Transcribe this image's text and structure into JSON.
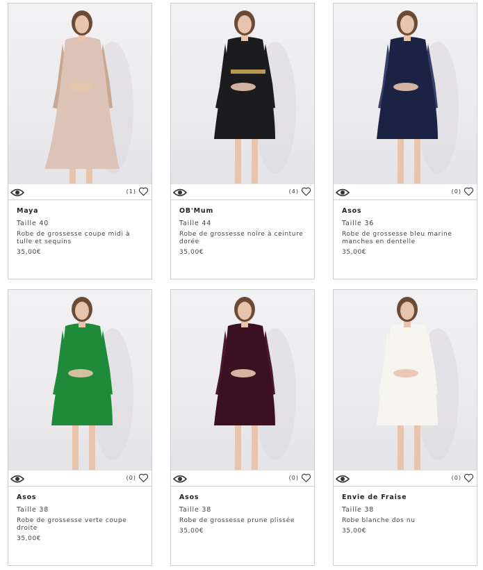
{
  "products": [
    {
      "brand": "Maya",
      "size": "Taille 40",
      "description": "Robe de grossesse coupe midi à tulle et sequins",
      "price": "35,00€",
      "likes": "(1)",
      "dress_color": "#dcc3b5",
      "sleeve_color": "#c7a894"
    },
    {
      "brand": "OB'Mum",
      "size": "Taille 44",
      "description": "Robe de grossesse noire à ceinture dorée",
      "price": "35,00€",
      "likes": "(4)",
      "dress_color": "#1c1c1e",
      "sleeve_color": "#1c1c1e",
      "belt_color": "#b79a52"
    },
    {
      "brand": "Asos",
      "size": "Taille 36",
      "description": "Robe de grossesse bleu marine manches en dentelle",
      "price": "35,00€",
      "likes": "(0)",
      "dress_color": "#1b2244",
      "sleeve_color": "#39406a"
    },
    {
      "brand": "Asos",
      "size": "Taille 38",
      "description": "Robe de grossesse verte coupe droite",
      "price": "35,00€",
      "likes": "(0)",
      "dress_color": "#1f8a3a",
      "sleeve_color": "#1f8a3a"
    },
    {
      "brand": "Asos",
      "size": "Taille 38",
      "description": "Robe de grossesse prune plissée",
      "price": "35,00€",
      "likes": "(0)",
      "dress_color": "#3b1020",
      "sleeve_color": "#4a1a2c"
    },
    {
      "brand": "Envie de Fraise",
      "size": "Taille 38",
      "description": "Robe blanche dos nu",
      "price": "35,00€",
      "likes": "(0)",
      "dress_color": "#f6f5f0",
      "sleeve_color": "#f6f5f0"
    }
  ]
}
